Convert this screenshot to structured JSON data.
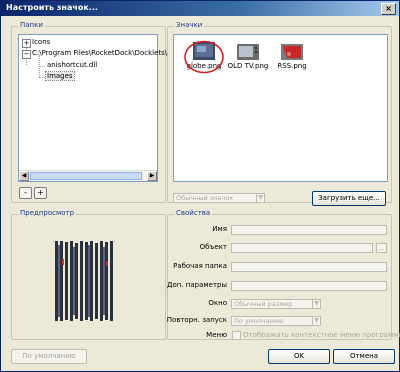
{
  "window": {
    "title": "Настроить значок...",
    "close_glyph": "×"
  },
  "folders": {
    "label": "Папки",
    "items": [
      {
        "text": "Icons",
        "expander": "+"
      },
      {
        "text": "C:\\Program Files\\RocketDock\\Docklets\\",
        "expander": "−"
      },
      {
        "text": "anishortcut.dll"
      },
      {
        "text": "Images"
      }
    ],
    "remove_label": "-",
    "add_label": "+"
  },
  "icons": {
    "label": "Значки",
    "items": [
      {
        "caption": "globe.png"
      },
      {
        "caption": "OLD TV.png"
      },
      {
        "caption": "RSS.png"
      }
    ],
    "dropdown_value": "Обычный значок",
    "load_button": "Загрузить еще..."
  },
  "preview": {
    "label": "Предпросмотр"
  },
  "properties": {
    "label": "Свойства",
    "name_label": "Имя",
    "object_label": "Объект",
    "browse_label": "...",
    "workdir_label": "Рабочая папка",
    "params_label": "Доп. параметры",
    "window_label": "Окно",
    "window_value": "Обычный размер",
    "relaunch_label": "Повторн. запуск",
    "relaunch_value": "По умолчанию",
    "menu_label": "Меню",
    "menu_checkbox_label": "Отображать контекстное меню программы"
  },
  "footer": {
    "default_button": "По умолчанию",
    "ok_button": "OK",
    "cancel_button": "Отмена"
  }
}
